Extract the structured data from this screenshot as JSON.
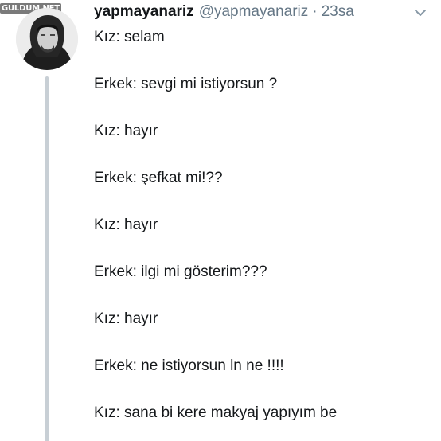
{
  "watermark": "GULDUM.NET",
  "tweet": {
    "display_name": "yapmayanariz",
    "handle": "@yapmayanariz",
    "separator": "·",
    "time": "23sa",
    "lines": [
      "Kız: selam",
      "Erkek: sevgi mi istiyorsun ?",
      "Kız: hayır",
      "Erkek: şefkat mi!??",
      "Kız: hayır",
      "Erkek: ilgi mi gösterim???",
      "Kız: hayır",
      "Erkek: ne istiyorsun ln ne !!!!",
      "Kız: sana bi kere makyaj yapıyım be"
    ]
  },
  "icons": {
    "menu": "chevron-down-icon",
    "avatar": "avatar"
  },
  "colors": {
    "text": "#14171a",
    "muted": "#657786",
    "thread_line": "#c8cfd5"
  }
}
